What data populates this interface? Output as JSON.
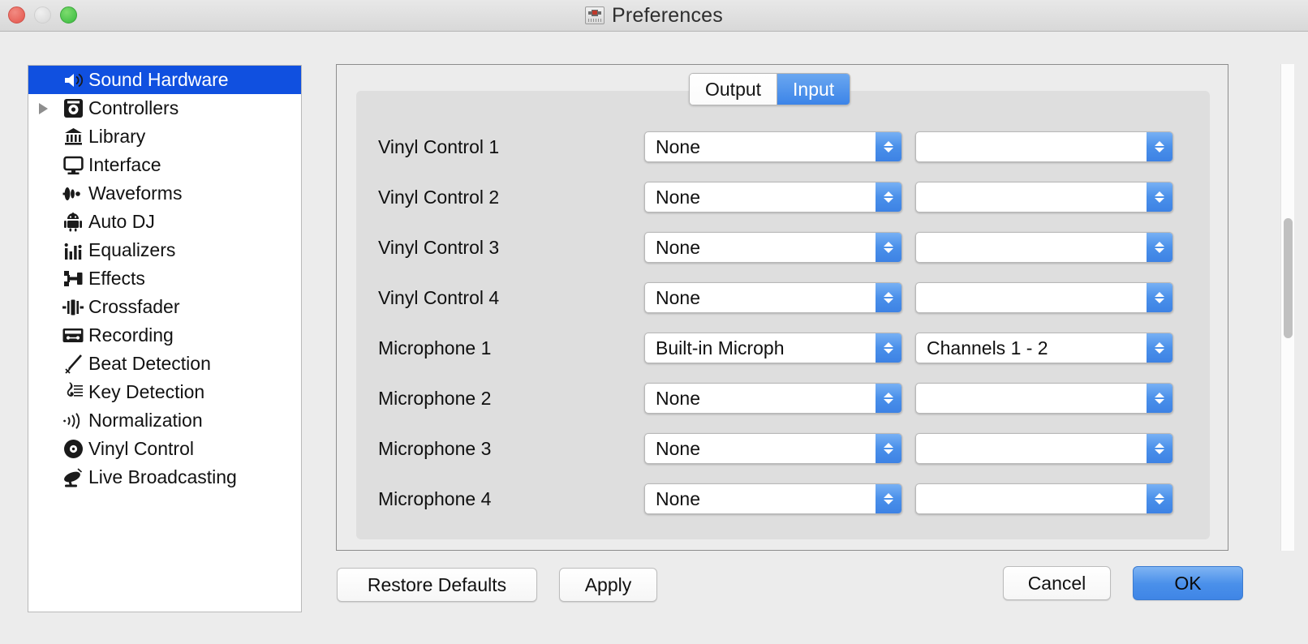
{
  "window": {
    "title": "Preferences",
    "icon": "mixer-hardware-icon",
    "traffic_lights": [
      {
        "name": "close",
        "color": "#e8655c"
      },
      {
        "name": "minimize",
        "color": "#dedede"
      },
      {
        "name": "zoom",
        "color": "#4cc44c"
      }
    ]
  },
  "sidebar": {
    "items": [
      {
        "label": "Sound Hardware",
        "icon": "speaker-icon",
        "selected": true,
        "expandable": false
      },
      {
        "label": "Controllers",
        "icon": "controller-icon",
        "selected": false,
        "expandable": true
      },
      {
        "label": "Library",
        "icon": "library-columns-icon",
        "selected": false,
        "expandable": false
      },
      {
        "label": "Interface",
        "icon": "monitor-icon",
        "selected": false,
        "expandable": false
      },
      {
        "label": "Waveforms",
        "icon": "waveform-icon",
        "selected": false,
        "expandable": false
      },
      {
        "label": "Auto DJ",
        "icon": "robot-icon",
        "selected": false,
        "expandable": false
      },
      {
        "label": "Equalizers",
        "icon": "equalizer-bars-icon",
        "selected": false,
        "expandable": false
      },
      {
        "label": "Effects",
        "icon": "effects-icon",
        "selected": false,
        "expandable": false
      },
      {
        "label": "Crossfader",
        "icon": "crossfader-icon",
        "selected": false,
        "expandable": false
      },
      {
        "label": "Recording",
        "icon": "cassette-icon",
        "selected": false,
        "expandable": false
      },
      {
        "label": "Beat Detection",
        "icon": "metronome-wand-icon",
        "selected": false,
        "expandable": false
      },
      {
        "label": "Key Detection",
        "icon": "treble-clef-icon",
        "selected": false,
        "expandable": false
      },
      {
        "label": "Normalization",
        "icon": "sound-waves-icon",
        "selected": false,
        "expandable": false
      },
      {
        "label": "Vinyl Control",
        "icon": "vinyl-record-icon",
        "selected": false,
        "expandable": false
      },
      {
        "label": "Live Broadcasting",
        "icon": "satellite-dish-icon",
        "selected": false,
        "expandable": false
      }
    ]
  },
  "tabs": [
    {
      "label": "Output",
      "active": false
    },
    {
      "label": "Input",
      "active": true
    }
  ],
  "colors": {
    "selection_blue": "#1050e0",
    "accent_blue": "#4a90ea",
    "panel_gray": "#dedede",
    "window_gray": "#ececec"
  },
  "rows": [
    {
      "label": "Vinyl Control 1",
      "device": "None",
      "channel": ""
    },
    {
      "label": "Vinyl Control 2",
      "device": "None",
      "channel": ""
    },
    {
      "label": "Vinyl Control 3",
      "device": "None",
      "channel": ""
    },
    {
      "label": "Vinyl Control 4",
      "device": "None",
      "channel": ""
    },
    {
      "label": "Microphone 1",
      "device": "Built-in Microph",
      "channel": "Channels 1 - 2"
    },
    {
      "label": "Microphone 2",
      "device": "None",
      "channel": ""
    },
    {
      "label": "Microphone 3",
      "device": "None",
      "channel": ""
    },
    {
      "label": "Microphone 4",
      "device": "None",
      "channel": ""
    }
  ],
  "buttons": {
    "restore_defaults": "Restore Defaults",
    "apply": "Apply",
    "cancel": "Cancel",
    "ok": "OK"
  },
  "scrollbar": {
    "orientation": "vertical",
    "thumb_top_pct": 32,
    "thumb_height_pct": 25
  }
}
